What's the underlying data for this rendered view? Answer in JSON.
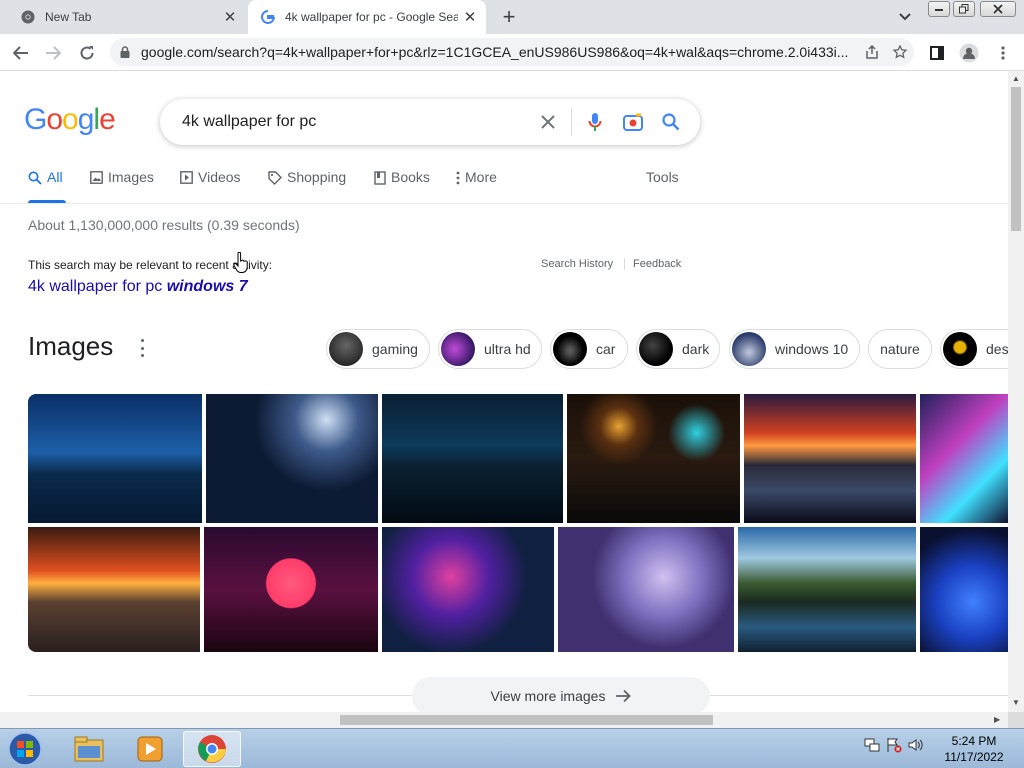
{
  "browser": {
    "tabs": [
      {
        "title": "New Tab"
      },
      {
        "title": "4k wallpaper for pc - Google Sea"
      }
    ],
    "url": "google.com/search?q=4k+wallpaper+for+pc&rlz=1C1GCEA_enUS986US986&oq=4k+wal&aqs=chrome.2.0i433i..."
  },
  "google": {
    "logo_letters": [
      "G",
      "o",
      "o",
      "g",
      "l",
      "e"
    ],
    "query": "4k wallpaper for pc",
    "tabs": [
      "All",
      "Images",
      "Videos",
      "Shopping",
      "Books",
      "More"
    ],
    "tools": "Tools",
    "stats": "About 1,130,000,000 results (0.39 seconds)",
    "relevant_text": "This search may be relevant to recent activity:",
    "search_history": "Search History",
    "feedback": "Feedback",
    "suggestion_plain": "4k wallpaper for pc ",
    "suggestion_bold": "windows 7",
    "images_heading": "Images",
    "chips": [
      "gaming",
      "ultra hd",
      "car",
      "dark",
      "windows 10",
      "nature",
      "des"
    ],
    "view_more": "View more images"
  },
  "taskbar": {
    "time": "5:24 PM",
    "date": "11/17/2022"
  },
  "colors": {
    "google_blue": "#4285f4",
    "google_red": "#ea4335",
    "google_yellow": "#fbbc05",
    "google_green": "#34a853",
    "link_blue": "#1a0dab",
    "active_tab_blue": "#1a73e8"
  }
}
